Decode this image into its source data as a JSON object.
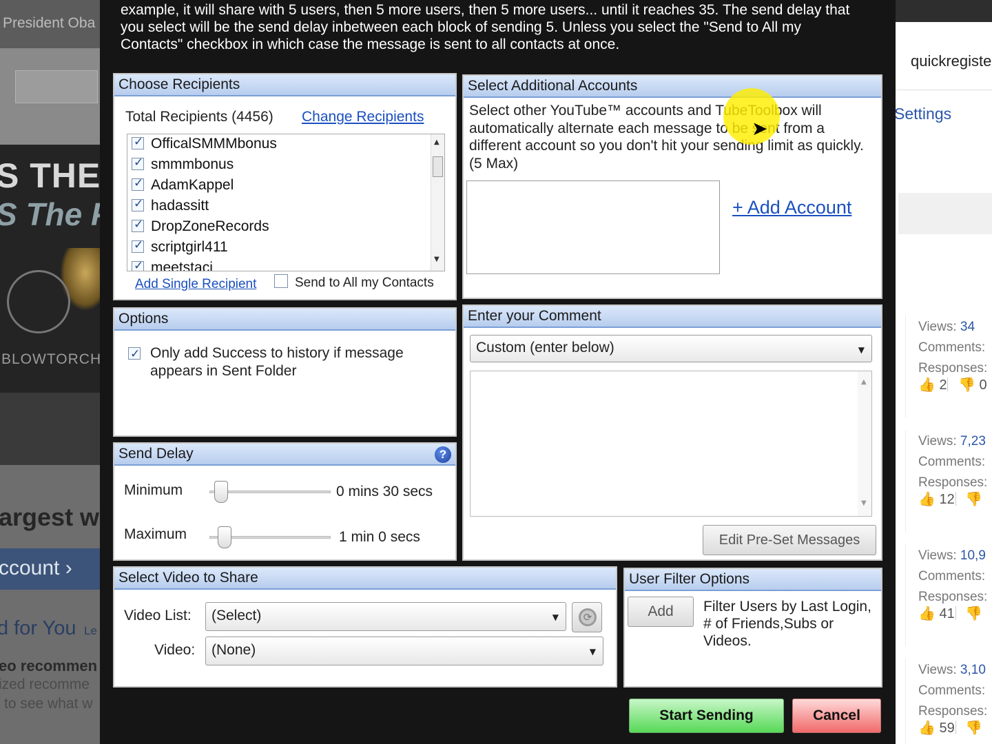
{
  "background_left": {
    "president_text": "President Oba",
    "headline_1": "S THE H",
    "headline_2": "S The P",
    "blowtorch": "BLOWTORCH",
    "largest": "argest w",
    "account_link": "ccount ›",
    "for_you": "d for You",
    "for_you_suffix": "Le",
    "video_recommendations": "eo recommen",
    "personalized_recommendations": "ized recomme",
    "see_what": "to see what w"
  },
  "background_right": {
    "username": "quickregiste",
    "settings": "Settings",
    "cards": [
      {
        "views_label": "Views:",
        "views_value": "34",
        "comments_label": "Comments:",
        "responses_label": "Responses:",
        "likes": "2",
        "dislikes": "0"
      },
      {
        "views_label": "Views:",
        "views_value": "7,23",
        "comments_label": "Comments:",
        "responses_label": "Responses:",
        "likes": "12",
        "dislikes": ""
      },
      {
        "views_label": "Views:",
        "views_value": "10,9",
        "comments_label": "Comments:",
        "responses_label": "Responses:",
        "likes": "41",
        "dislikes": ""
      },
      {
        "views_label": "Views:",
        "views_value": "3,10",
        "comments_label": "Comments:",
        "responses_label": "Responses:",
        "likes": "59",
        "dislikes": ""
      }
    ]
  },
  "dialog": {
    "info_text": "example, it will share with 5 users, then 5 more users, then 5 more users... until it reaches 35. The send delay that you select will be the send delay inbetween each block of sending 5. Unless you select the \"Send to All my Contacts\" checkbox in which case the message is sent to all contacts at once.",
    "recipients": {
      "header": "Choose Recipients",
      "total": "Total Recipients (4456)",
      "change_link": "Change Recipients",
      "items": [
        {
          "name": "OfficalSMMMbonus",
          "checked": true
        },
        {
          "name": "smmmbonus",
          "checked": true
        },
        {
          "name": "AdamKappel",
          "checked": true
        },
        {
          "name": "hadassitt",
          "checked": true
        },
        {
          "name": "DropZoneRecords",
          "checked": true
        },
        {
          "name": "scriptgirl411",
          "checked": true
        },
        {
          "name": "meetstaci",
          "checked": true
        }
      ],
      "add_single": "Add Single Recipient",
      "send_to_all": "Send to All my Contacts",
      "send_to_all_checked": false
    },
    "accounts": {
      "header": "Select Additional Accounts",
      "description": "Select other YouTube™ accounts and TubeToolbox will automatically alternate each message to be sent from a different account so you don't hit your sending limit as quickly. (5 Max)",
      "add_account": "+ Add Account"
    },
    "options": {
      "header": "Options",
      "history_label": "Only add Success to history if message appears in Sent Folder",
      "history_checked": true
    },
    "delay": {
      "header": "Send Delay",
      "help_icon": "?",
      "minimum_label": "Minimum",
      "minimum_value": "0 mins 30 secs",
      "minimum_position": 0.04,
      "maximum_label": "Maximum",
      "maximum_value": "1 min 0 secs",
      "maximum_position": 0.07
    },
    "comment": {
      "header": "Enter your Comment",
      "select_value": "Custom (enter below)",
      "text_value": "",
      "edit_preset": "Edit Pre-Set Messages"
    },
    "video": {
      "header": "Select Video to Share",
      "list_label": "Video List:",
      "list_value": "(Select)",
      "video_label": "Video:",
      "video_value": "(None)"
    },
    "filter": {
      "header": "User Filter Options",
      "add_button": "Add",
      "description": "Filter Users by Last Login, # of Friends,Subs or Videos."
    },
    "start_button": "Start Sending",
    "cancel_button": "Cancel"
  },
  "colors": {
    "panel_header": "#b7cdee",
    "link": "#1a4fbf",
    "start_button": "#57d957",
    "cancel_button": "#f06a6a",
    "cursor_highlight": "#ffee00"
  },
  "icons": [
    "refresh-icon",
    "help-icon",
    "chevron-down-icon",
    "scroll-up-icon",
    "scroll-down-icon",
    "thumbs-up-icon",
    "thumbs-down-icon",
    "mouse-cursor-icon"
  ]
}
